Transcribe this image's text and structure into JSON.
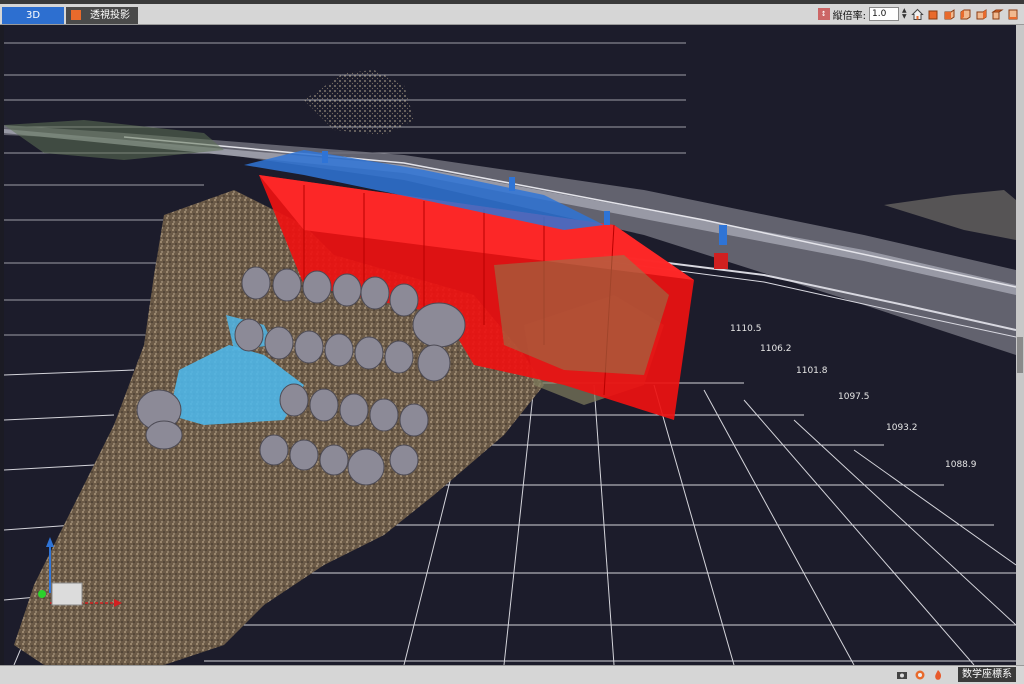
{
  "tabs": [
    {
      "label": "3D",
      "active": true
    },
    {
      "label": "透視投影",
      "icon": "cube-icon"
    }
  ],
  "toolbar": {
    "vertical_exaggeration_label": "縦倍率:",
    "vertical_exaggeration_value": "1.0",
    "view_buttons": [
      "home-icon",
      "view-front-icon",
      "view-back-icon",
      "view-left-icon",
      "view-right-icon",
      "view-top-icon",
      "view-bottom-icon"
    ]
  },
  "elevation_labels": [
    "1110.5",
    "1106.2",
    "1101.8",
    "1097.5",
    "1093.2",
    "1088.9"
  ],
  "status": {
    "icons": [
      "camera-icon",
      "settings-icon",
      "fire-icon"
    ],
    "coordinate_button": "数学座標系"
  },
  "colors": {
    "viewport_bg": "#1c1c2b",
    "active_tab": "#2d6fd0",
    "overlay_red": "#ee1111",
    "grid_line": "#e8e8ee"
  }
}
